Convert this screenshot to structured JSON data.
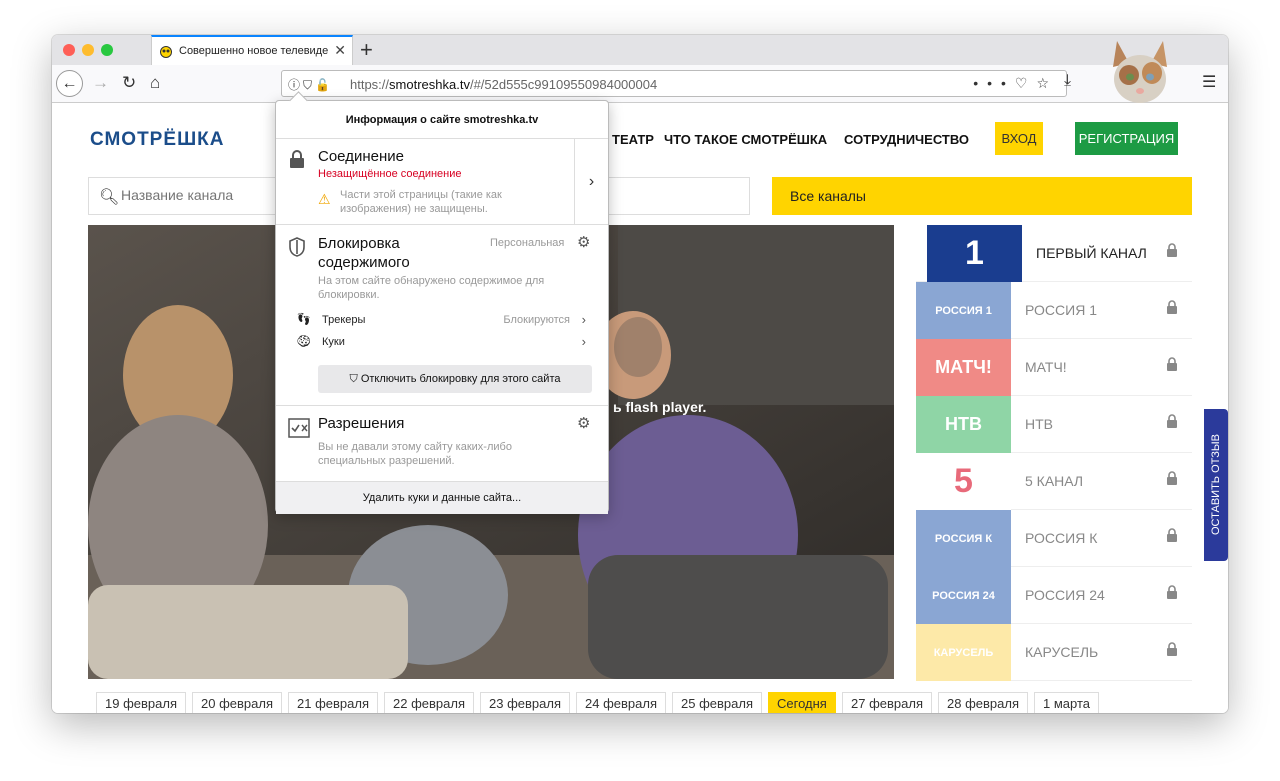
{
  "tab": {
    "title": "Совершенно новое телевидение"
  },
  "url": {
    "prefix": "https://",
    "host": "smotreshka.tv",
    "path": "/#/52d555c99109550984000004"
  },
  "site": {
    "logo": "СМОТРЁШКА",
    "nav": [
      "ТЕАТР",
      "ЧТО ТАКОЕ СМОТРЁШКА",
      "СОТРУДНИЧЕСТВО"
    ],
    "login": "ВХОД",
    "register": "РЕГИСТРАЦИЯ",
    "search_placeholder": "Название канала",
    "all_channels": "Все каналы",
    "flash_msg": "ь flash player.",
    "feedback": "ОСТАВИТЬ ОТЗЫВ",
    "channels": [
      {
        "name": "ПЕРВЫЙ КАНАЛ",
        "logo": "1",
        "color": "#1a3d8f",
        "active": true
      },
      {
        "name": "РОССИЯ 1",
        "logo": "РОССИЯ 1",
        "color": "#8aa6d3",
        "active": false
      },
      {
        "name": "МАТЧ!",
        "logo": "МАТЧ!",
        "color": "#f08a86",
        "active": false
      },
      {
        "name": "НТВ",
        "logo": "НТВ",
        "color": "#8fd5a6",
        "active": false
      },
      {
        "name": "5 КАНАЛ",
        "logo": "5",
        "color": "#ffffff",
        "active": false
      },
      {
        "name": "РОССИЯ К",
        "logo": "РОССИЯ К",
        "color": "#8aa6d3",
        "active": false
      },
      {
        "name": "РОССИЯ 24",
        "logo": "РОССИЯ 24",
        "color": "#8aa6d3",
        "active": false
      },
      {
        "name": "КАРУСЕЛЬ",
        "logo": "КАРУСЕЛЬ",
        "color": "#fde9a8",
        "active": false
      }
    ],
    "dates": [
      {
        "label": "19 февраля",
        "today": false
      },
      {
        "label": "20 февраля",
        "today": false
      },
      {
        "label": "21 февраля",
        "today": false
      },
      {
        "label": "22 февраля",
        "today": false
      },
      {
        "label": "23 февраля",
        "today": false
      },
      {
        "label": "24 февраля",
        "today": false
      },
      {
        "label": "25 февраля",
        "today": false
      },
      {
        "label": "Сегодня",
        "today": true
      },
      {
        "label": "27 февраля",
        "today": false
      },
      {
        "label": "28 февраля",
        "today": false
      },
      {
        "label": "1 марта",
        "today": false
      }
    ]
  },
  "panel": {
    "title": "Информация о сайте smotreshka.tv",
    "connection": {
      "heading": "Соединение",
      "status": "Незащищённое соединение",
      "warning": "Части этой страницы (такие как изображения) не защищены."
    },
    "blocking": {
      "heading": "Блокировка содержимого",
      "mode": "Персональная",
      "desc": "На этом сайте обнаружено содержимое для блокировки.",
      "trackers_label": "Трекеры",
      "trackers_value": "Блокируются",
      "cookies_label": "Куки",
      "disable_btn": "Отключить блокировку для этого сайта"
    },
    "permissions": {
      "heading": "Разрешения",
      "desc": "Вы не давали этому сайту каких-либо специальных разрешений."
    },
    "clear": "Удалить куки и данные сайта..."
  }
}
